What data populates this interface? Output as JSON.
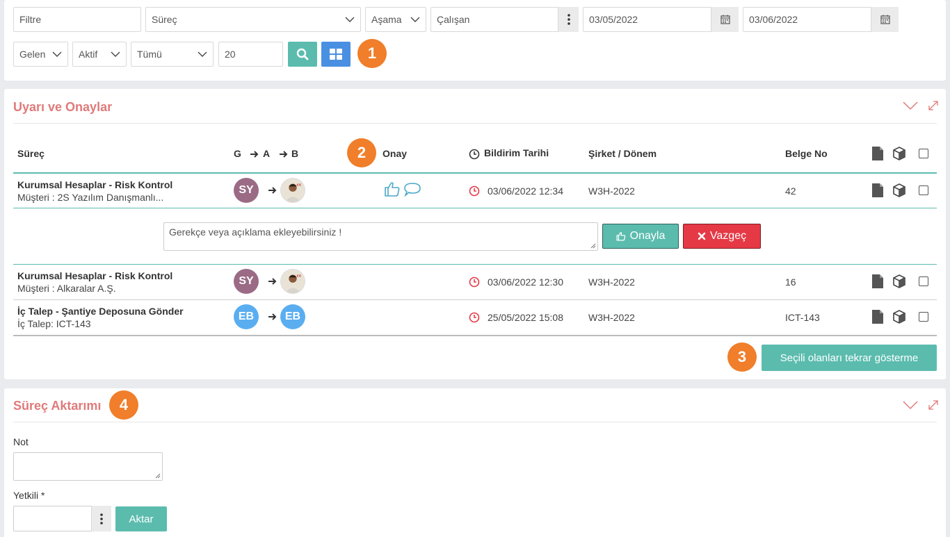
{
  "filters": {
    "filtre_placeholder": "Filtre",
    "surec_value": "Süreç",
    "asama_value": "Aşama",
    "calisan_value": "Çalışan",
    "date_start": "03/05/2022",
    "date_end": "03/06/2022",
    "gelen_value": "Gelen",
    "aktif_value": "Aktif",
    "tumu_value": "Tümü",
    "count_value": "20"
  },
  "badges": {
    "b1": "1",
    "b2": "2",
    "b3": "3",
    "b4": "4"
  },
  "alerts": {
    "title": "Uyarı ve Onaylar",
    "headers": {
      "surec": "Süreç",
      "g": "G",
      "a": "A",
      "b": "B",
      "onay": "Onay",
      "bildirim_tarihi": "Bildirim Tarihi",
      "sirket_donem": "Şirket / Dönem",
      "belge_no": "Belge No"
    },
    "rows": [
      {
        "title": "Kurumsal Hesaplar - Risk Kontrol",
        "subtitle": "Müşteri : 2S Yazılım Danışmanlı...",
        "g_initials": "SY",
        "date": "03/06/2022 12:34",
        "company": "W3H-2022",
        "doc_no": "42"
      },
      {
        "title": "Kurumsal Hesaplar - Risk Kontrol",
        "subtitle": "Müşteri : Alkaralar A.Ş.",
        "g_initials": "SY",
        "date": "03/06/2022 12:30",
        "company": "W3H-2022",
        "doc_no": "16"
      },
      {
        "title": "İç Talep - Şantiye Deposuna Gönder",
        "subtitle": "İç Talep: ICT-143",
        "g_initials": "EB",
        "b_initials": "EB",
        "date": "25/05/2022 15:08",
        "company": "W3H-2022",
        "doc_no": "ICT-143"
      }
    ],
    "comment_placeholder": "Gerekçe veya açıklama ekleyebilirsiniz !",
    "approve_label": "Onayla",
    "cancel_label": "Vazgeç",
    "hide_selected_label": "Seçili olanları tekrar gösterme"
  },
  "transfer": {
    "title": "Süreç Aktarımı",
    "note_label": "Not",
    "yetkili_label": "Yetkili *",
    "aktar_label": "Aktar"
  },
  "colors": {
    "accent_teal": "#5bbcae",
    "accent_blue": "#4a90e2",
    "badge_orange": "#f07e2a",
    "title_red": "#e07a7a",
    "danger": "#e53945"
  },
  "icons": [
    "search-icon",
    "grid-icon",
    "calendar-icon",
    "kebab-icon",
    "chevron-down-icon",
    "expand-icon",
    "document-icon",
    "cube-icon",
    "clock-icon",
    "thumbs-up-icon",
    "comment-icon",
    "arrow-right-icon",
    "close-icon"
  ]
}
